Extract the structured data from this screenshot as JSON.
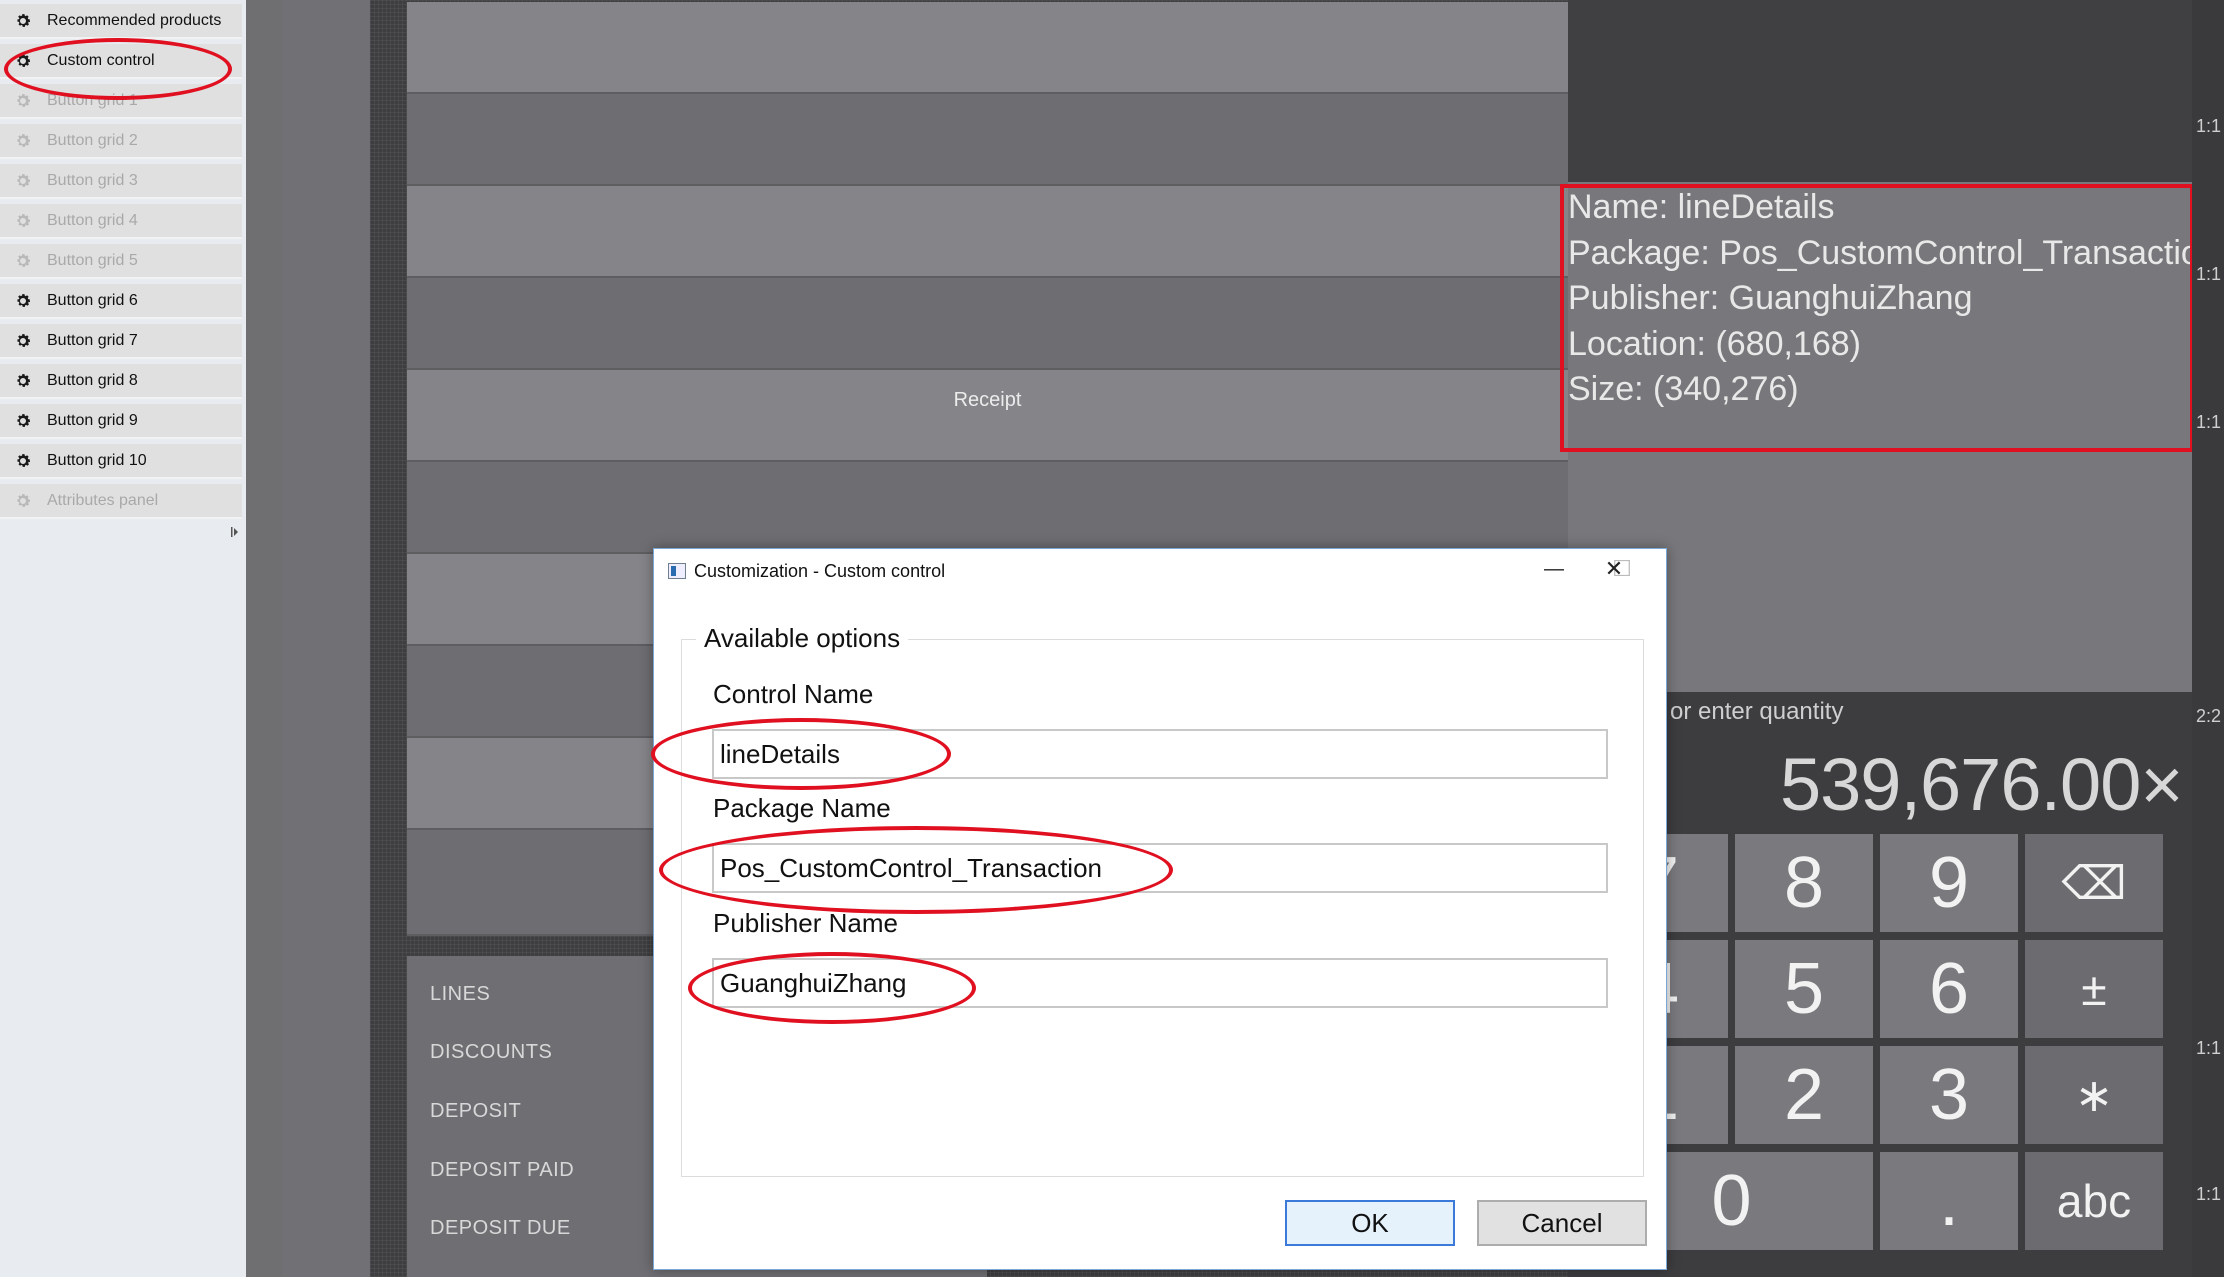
{
  "sidebar": {
    "items": [
      {
        "label": "Recommended products",
        "enabled": true
      },
      {
        "label": "Custom control",
        "enabled": true
      },
      {
        "label": "Button grid 1",
        "enabled": false
      },
      {
        "label": "Button grid 2",
        "enabled": false
      },
      {
        "label": "Button grid 3",
        "enabled": false
      },
      {
        "label": "Button grid 4",
        "enabled": false
      },
      {
        "label": "Button grid 5",
        "enabled": false
      },
      {
        "label": "Button grid 6",
        "enabled": true
      },
      {
        "label": "Button grid 7",
        "enabled": true
      },
      {
        "label": "Button grid 8",
        "enabled": true
      },
      {
        "label": "Button grid 9",
        "enabled": true
      },
      {
        "label": "Button grid 10",
        "enabled": true
      },
      {
        "label": "Attributes panel",
        "enabled": false
      }
    ]
  },
  "canvas": {
    "receipt_label": "Receipt",
    "totals": [
      "LINES",
      "DISCOUNTS",
      "DEPOSIT",
      "DEPOSIT PAID",
      "DEPOSIT DUE"
    ],
    "info": {
      "name": "Name: lineDetails",
      "package": "Package: Pos_CustomControl_Transaction",
      "publisher": "Publisher: GuanghuiZhang",
      "location": "Location: (680,168)",
      "size": "Size: (340,276)"
    },
    "ratios": [
      "1:1",
      "1:1",
      "1:1",
      "2:2",
      "1:1",
      "1:1"
    ],
    "numpad": {
      "hint": "or enter quantity",
      "value": "539,676.00×",
      "keys": [
        "7",
        "8",
        "9",
        "⌫",
        "4",
        "5",
        "6",
        "±",
        "1",
        "2",
        "3",
        "∗",
        "0",
        ".",
        "abc"
      ]
    }
  },
  "dialog": {
    "title": "Customization - Custom control",
    "group_label": "Available options",
    "control_name_label": "Control Name",
    "control_name_value": "lineDetails",
    "package_name_label": "Package Name",
    "package_name_value": "Pos_CustomControl_Transaction",
    "publisher_name_label": "Publisher Name",
    "publisher_name_value": "GuanghuiZhang",
    "ok_label": "OK",
    "cancel_label": "Cancel",
    "minimize_glyph": "—",
    "maximize_glyph": "☐",
    "close_glyph": "✕"
  },
  "colors": {
    "highlight": "#e01020",
    "ok_border": "#3b7ad9"
  }
}
